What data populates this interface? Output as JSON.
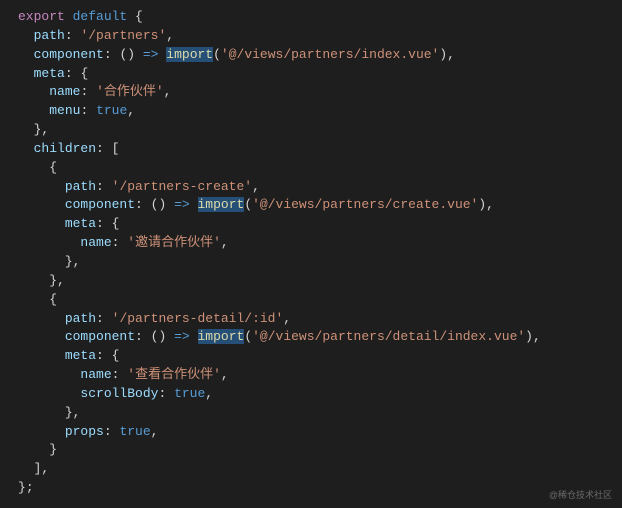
{
  "code": {
    "l1_export": "export",
    "l1_default": "default",
    "l2_path": "path",
    "l2_path_v": "'/partners'",
    "l3_comp": "component",
    "l3_import": "import",
    "l3_import_arg": "'@/views/partners/index.vue'",
    "l4_meta": "meta",
    "l5_name": "name",
    "l5_name_v": "'合作伙伴'",
    "l6_menu": "menu",
    "l6_menu_v": "true",
    "l8_children": "children",
    "c1_path": "path",
    "c1_path_v": "'/partners-create'",
    "c1_comp": "component",
    "c1_import": "import",
    "c1_import_arg": "'@/views/partners/create.vue'",
    "c1_meta": "meta",
    "c1_name": "name",
    "c1_name_v": "'邀请合作伙伴'",
    "c2_path": "path",
    "c2_path_v": "'/partners-detail/:id'",
    "c2_comp": "component",
    "c2_import": "import",
    "c2_import_arg": "'@/views/partners/detail/index.vue'",
    "c2_meta": "meta",
    "c2_name": "name",
    "c2_name_v": "'查看合作伙伴'",
    "c2_scroll": "scrollBody",
    "c2_scroll_v": "true",
    "c2_props": "props",
    "c2_props_v": "true"
  },
  "watermark": "@稀仓技术社区"
}
